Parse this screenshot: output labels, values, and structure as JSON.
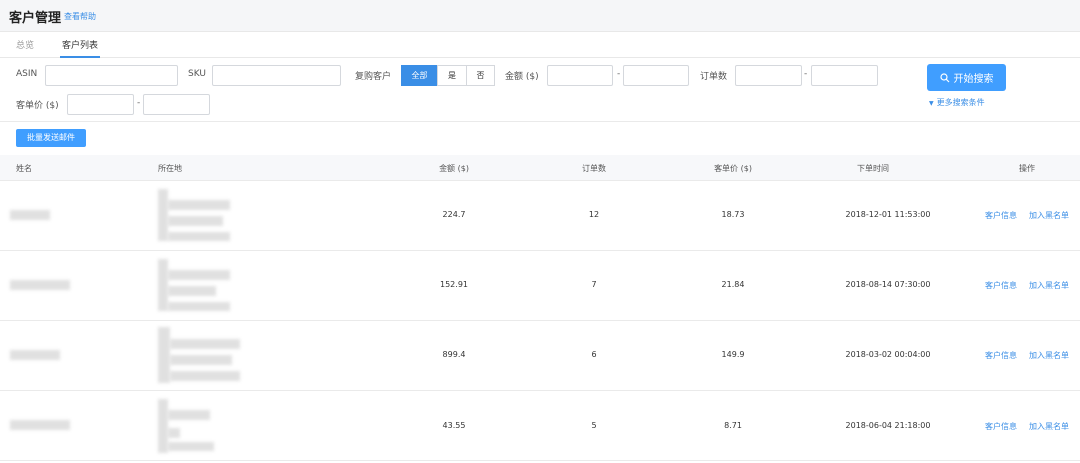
{
  "header": {
    "title": "客户管理",
    "help_link": "查看帮助"
  },
  "tabs": [
    {
      "label": "总览",
      "active": false
    },
    {
      "label": "客户列表",
      "active": true
    }
  ],
  "filters": {
    "asin_label": "ASIN",
    "sku_label": "SKU",
    "repurchase_label": "复购客户",
    "repurchase_options": [
      "全部",
      "是",
      "否"
    ],
    "repurchase_selected": "全部",
    "amount_label": "金额 ($)",
    "orders_label": "订单数",
    "unit_price_label": "客单价 ($)",
    "range_sep": "-",
    "search_button": "开始搜索",
    "more_conditions": "更多搜索条件"
  },
  "batch_email_button": "批量发送邮件",
  "table": {
    "columns": [
      "姓名",
      "所在地",
      "金额 ($)",
      "订单数",
      "客单价 ($)",
      "下单时间",
      "操作"
    ],
    "rows": [
      {
        "amount": "224.7",
        "orders": "12",
        "unit_price": "18.73",
        "time": "2018-12-01 11:53:00"
      },
      {
        "amount": "152.91",
        "orders": "7",
        "unit_price": "21.84",
        "time": "2018-08-14 07:30:00"
      },
      {
        "amount": "899.4",
        "orders": "6",
        "unit_price": "149.9",
        "time": "2018-03-02 00:04:00"
      },
      {
        "amount": "43.55",
        "orders": "5",
        "unit_price": "8.71",
        "time": "2018-06-04 21:18:00"
      }
    ],
    "actions": {
      "info": "客户信息",
      "blacklist": "加入黑名单"
    }
  },
  "colors": {
    "accent": "#409eff",
    "link": "#3a8ee6"
  },
  "icons": {
    "search": "search-icon",
    "more": "caret-down-icon"
  }
}
